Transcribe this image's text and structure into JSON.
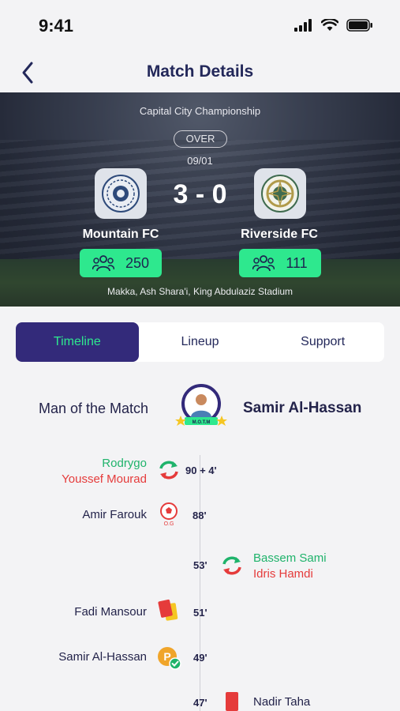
{
  "status": {
    "time": "9:41"
  },
  "nav": {
    "title": "Match Details"
  },
  "match": {
    "competition": "Capital City Championship",
    "state": "OVER",
    "date": "09/01",
    "score": "3 - 0",
    "home": {
      "name": "Mountain FC",
      "fans": "250"
    },
    "away": {
      "name": "Riverside FC",
      "fans": "111"
    },
    "venue": "Makka, Ash Shara'i, King Abdulaziz Stadium"
  },
  "tabs": [
    {
      "label": "Timeline"
    },
    {
      "label": "Lineup"
    },
    {
      "label": "Support"
    }
  ],
  "motm": {
    "label": "Man of the Match",
    "name": "Samir Al-Hassan",
    "badge": "M.O.T.M"
  },
  "events": [
    {
      "minute": "90 + 4'",
      "in": "Rodrygo",
      "out": "Youssef Mourad",
      "type": "substitution",
      "side": "home"
    },
    {
      "minute": "88'",
      "player": "Amir Farouk",
      "type": "own-goal",
      "tag": "O.G",
      "side": "home"
    },
    {
      "minute": "53'",
      "in": "Bassem Sami",
      "out": "Idris Hamdi",
      "type": "substitution",
      "side": "away"
    },
    {
      "minute": "51'",
      "player": "Fadi Mansour",
      "type": "second-yellow-red",
      "side": "home"
    },
    {
      "minute": "49'",
      "player": "Samir Al-Hassan",
      "type": "penalty-scored",
      "tag": "P",
      "side": "home"
    },
    {
      "minute": "47'",
      "player": "Nadir Taha",
      "type": "red-card",
      "side": "away"
    }
  ],
  "colors": {
    "primary": "#332a7a",
    "accent": "#2ee88e",
    "sub_in": "#1fb36b",
    "sub_out": "#e53b3b"
  }
}
